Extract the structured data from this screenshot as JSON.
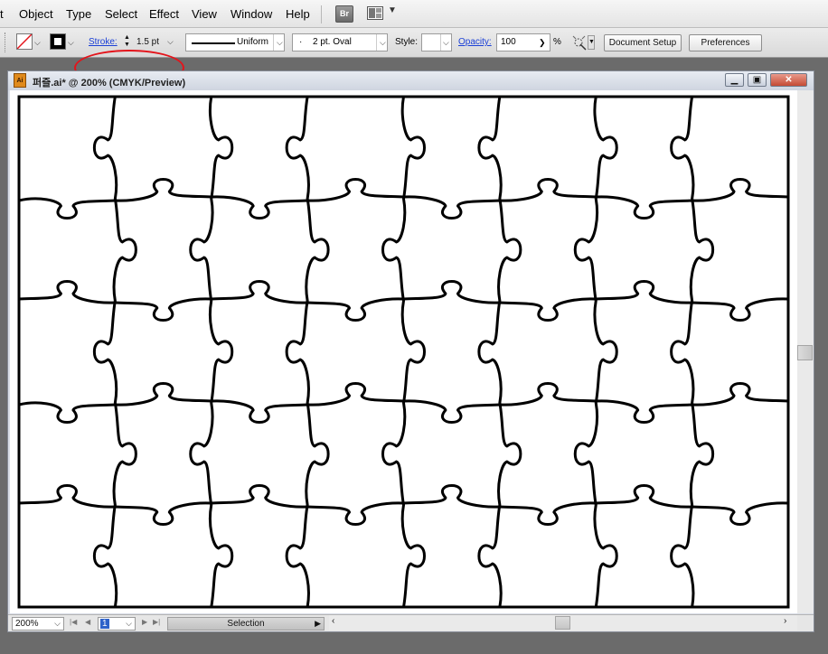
{
  "menubar": {
    "items": [
      "t",
      "Object",
      "Type",
      "Select",
      "Effect",
      "View",
      "Window",
      "Help"
    ],
    "bridge_label": "Br"
  },
  "controlbar": {
    "stroke_label": "Stroke:",
    "stroke_weight": "1.5 pt",
    "profile_value": "Uniform",
    "brush_value": "2 pt. Oval",
    "brush_dot": "·",
    "style_label": "Style:",
    "opacity_label": "Opacity:",
    "opacity_value": "100",
    "opacity_unit": "%",
    "document_setup_label": "Document Setup",
    "preferences_label": "Preferences"
  },
  "document": {
    "title": "퍼즐.ai* @ 200% (CMYK/Preview)",
    "icon_label": "Ai"
  },
  "statusbar": {
    "zoom": "200%",
    "page": "1",
    "tool": "Selection"
  },
  "colors": {
    "highlight": "#e4141b",
    "link": "#1a3fd6",
    "stroke": "#000000"
  },
  "icons": {
    "fill": "fill-none-swatch-icon",
    "stroke": "stroke-swatch-icon",
    "arrange": "arrange-documents-icon",
    "recolor": "recolor-artwork-icon"
  }
}
